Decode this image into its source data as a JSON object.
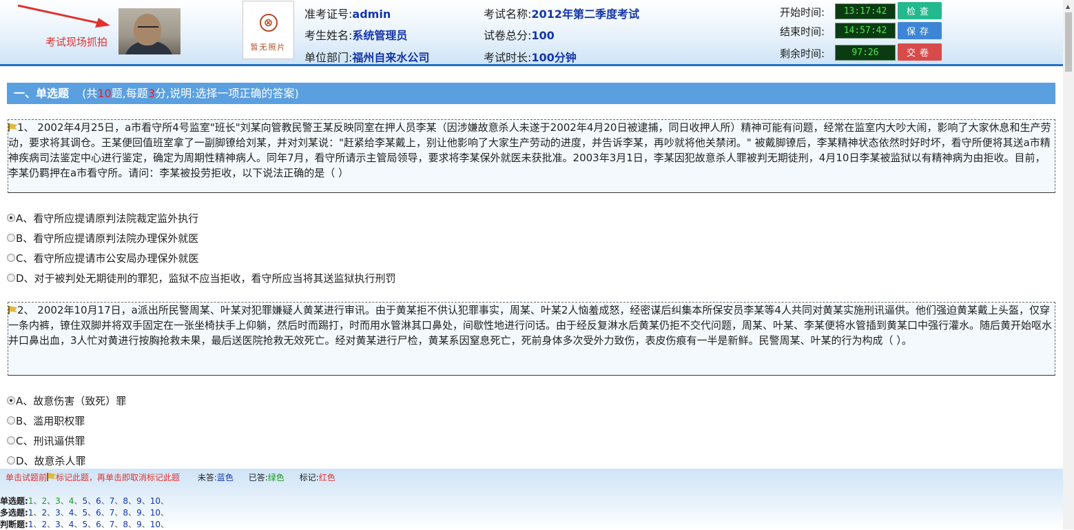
{
  "header": {
    "snapshot_label": "考试现场抓拍",
    "no_photo_text": "暂无照片",
    "ticket_label": "准考证号:",
    "ticket_value": "admin",
    "name_label": "考生姓名:",
    "name_value": "系统管理员",
    "dept_label": "单位部门:",
    "dept_value": "福州自来水公司",
    "exam_label": "考试名称:",
    "exam_value": "2012年第二季度考试",
    "total_label": "试卷总分:",
    "total_value": "100",
    "duration_label": "考试时长:",
    "duration_value": "100分钟",
    "start_label": "开始时间:",
    "start_value": "13:17:42",
    "end_label": "结束时间:",
    "end_value": "14:57:42",
    "remain_label": "剩余时间:",
    "remain_value": "97:26",
    "check_btn": "检查",
    "save_btn": "保存",
    "submit_btn": "交卷"
  },
  "section": {
    "title": "一、单选题",
    "p1": "(共",
    "count": "10",
    "p2": "题,每题",
    "score": "3",
    "p3": "分,说明:选择一项正确的答案)"
  },
  "questions": [
    {
      "text": "1、 2002年4月25日，a市看守所4号监室\"班长\"刘某向管教民警王某反映同室在押人员李某（因涉嫌故意杀人未遂于2002年4月20日被逮捕，同日收押人所）精神可能有问题，经常在监室内大吵大闹，影响了大家休息和生产劳动，要求将其调仓。王某便回值班室拿了一副脚镣给刘某，并对刘某说：\"赶紧给李某戴上，别让他影响了大家生产劳动的进度，并告诉李某，再吵就将他关禁闭。\" 被戴脚镣后，李某精神状态依然时好时坏，看守所便将其送a市精神疾病司法鉴定中心进行鉴定，确定为周期性精神病人。同年7月，看守所请示主管局领导，要求将李某保外就医未获批准。2003年3月1日，李某因犯故意杀人罪被判无期徒刑，4月10日李某被监狱以有精神病为由拒收。目前，李某仍羁押在a市看守所。请问：李某被投劳拒收，以下说法正确的是（    ）",
      "options": [
        "A、看守所应提请原判法院裁定监外执行",
        "B、看守所应提请原判法院办理保外就医",
        "C、看守所应提请市公安局办理保外就医",
        "D、对于被判处无期徒刑的罪犯，监狱不应当拒收，看守所应当将其送监狱执行刑罚"
      ]
    },
    {
      "text": "2、 2002年10月17日，a派出所民警周某、叶某对犯罪嫌疑人黄某进行审讯。由于黄某拒不供认犯罪事实，周某、叶某2人恼羞成怒，经密谋后纠集本所保安员李某等4人共同对黄某实施刑讯逼供。他们强迫黄某戴上头盔，仅穿一条内裤，镣住双脚并将双手固定在一张坐椅扶手上仰躺，然后时而踢打，时而用水管淋其口鼻处，间歇性地进行问话。由于经反复淋水后黄某仍拒不交代问题，周某、叶某、李某便将水管插到黄某口中强行灌水。随后黄开始呕水并口鼻出血，3人忙对黄进行按胸抢救未果，最后送医院抢救无效死亡。经对黄某进行尸检，黄某系因窒息死亡，死前身体多次受外力致伤，表皮伤痕有一半是新鲜。民警周某、叶某的行为构成（ ）。",
      "options": [
        "A、故意伤害（致死）罪",
        "B、滥用职权罪",
        "C、刑讯逼供罪",
        "D、故意杀人罪"
      ]
    }
  ],
  "footer": {
    "tip1": "单击试题前",
    "tip2": "标记此题，再单击即取消标记此题",
    "unanswered_label": "未答:",
    "unanswered_color": "蓝色",
    "answered_label": "已答:",
    "answered_color": "绿色",
    "marked_label": "标记:",
    "marked_color": "红色",
    "rows": [
      {
        "label": "单选题:",
        "nums": [
          "1",
          "2",
          "3",
          "4",
          "5",
          "6",
          "7",
          "8",
          "9",
          "10"
        ],
        "done": [
          true,
          true,
          true,
          true,
          false,
          false,
          false,
          false,
          false,
          false
        ]
      },
      {
        "label": "多选题:",
        "nums": [
          "1",
          "2",
          "3",
          "4",
          "5",
          "6",
          "7",
          "8",
          "9",
          "10"
        ],
        "done": [
          false,
          false,
          false,
          false,
          false,
          false,
          false,
          false,
          false,
          false
        ]
      },
      {
        "label": "判断题:",
        "nums": [
          "1",
          "2",
          "3",
          "4",
          "5",
          "6",
          "7",
          "8",
          "9",
          "10"
        ],
        "done": [
          false,
          false,
          false,
          false,
          false,
          false,
          false,
          false,
          false,
          false
        ]
      }
    ]
  },
  "colors": {
    "header_border": "#1f6fc4",
    "section_bg": "#5a9fe0",
    "timer_bg": "#0b3b12",
    "timer_text": "#4eea4e"
  }
}
